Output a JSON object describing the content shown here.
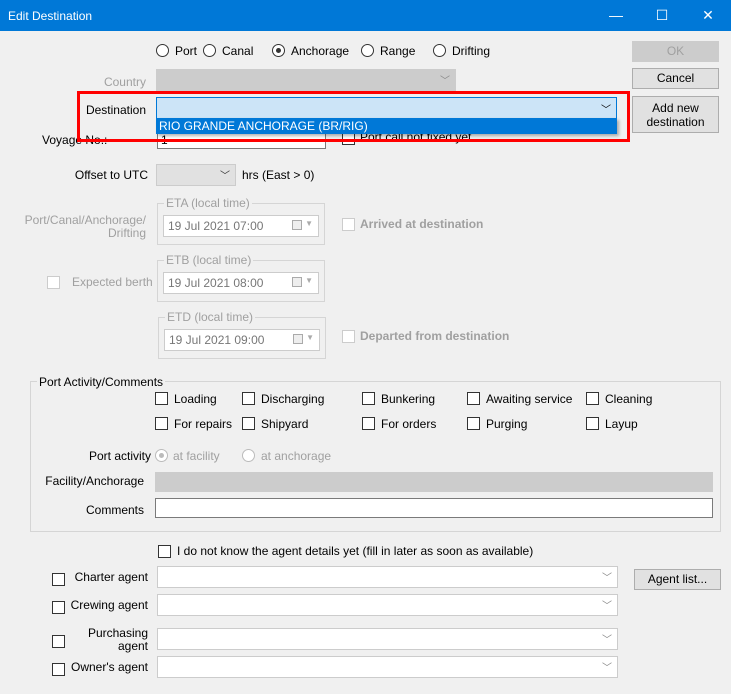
{
  "window": {
    "title": "Edit Destination",
    "minimize": "—",
    "maximize": "☐",
    "close": "✕"
  },
  "type_options": [
    {
      "label": "Port",
      "selected": false
    },
    {
      "label": "Canal",
      "selected": false
    },
    {
      "label": "Anchorage",
      "selected": true
    },
    {
      "label": "Range",
      "selected": false
    },
    {
      "label": "Drifting",
      "selected": false
    }
  ],
  "buttons": {
    "ok": "OK",
    "cancel": "Cancel",
    "add_new": "Add new destination",
    "agent_list": "Agent list..."
  },
  "country": {
    "label": "Country",
    "value": ""
  },
  "destination": {
    "label": "Destination",
    "value": "",
    "dropdown_item": "RIO GRANDE ANCHORAGE (BR/RIG)"
  },
  "voyage": {
    "label": "Voyage No.:",
    "value": "1",
    "port_call_label": "Port call not fixed yet"
  },
  "offset": {
    "label": "Offset to UTC",
    "value": "",
    "unit": "hrs (East > 0)"
  },
  "times": {
    "side_label": "Port/Canal/Anchorage/ Drifting",
    "eta_title": "ETA (local time)",
    "eta": "19  Jul   2021 07:00",
    "etb_title": "ETB (local time)",
    "etb": "19  Jul   2021 08:00",
    "etd_title": "ETD (local time)",
    "etd": "19  Jul   2021 09:00",
    "expected_berth": "Expected berth",
    "arrived": "Arrived at destination",
    "departed": "Departed from destination"
  },
  "activity": {
    "title": "Port Activity/Comments",
    "checks": [
      "Loading",
      "Discharging",
      "Bunkering",
      "Awaiting service",
      "Cleaning",
      "For repairs",
      "Shipyard",
      "For orders",
      "Purging",
      "Layup"
    ],
    "port_activity_label": "Port activity",
    "at_facility": "at facility",
    "at_anchorage": "at anchorage",
    "facility_label": "Facility/Anchorage",
    "facility_value": "",
    "comments_label": "Comments",
    "comments_value": ""
  },
  "agents": {
    "unknown_label": "I do not know the agent details yet (fill in later as soon as available)",
    "items": [
      "Charter agent",
      "Crewing agent",
      "Purchasing agent",
      "Owner's agent"
    ]
  },
  "colors": {
    "titlebar": "#0078d7",
    "highlight": "#ff0000",
    "selection": "#0078d7"
  }
}
